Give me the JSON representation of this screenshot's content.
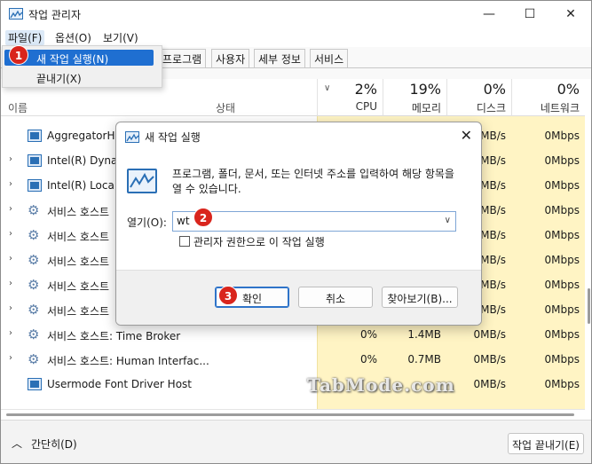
{
  "window": {
    "title": "작업 관리자",
    "controls": [
      "—",
      "☐",
      "✕"
    ]
  },
  "menubar": [
    {
      "label": "파일(F)"
    },
    {
      "label": "옵션(O)"
    },
    {
      "label": "보기(V)"
    }
  ],
  "file_menu": {
    "items": [
      {
        "label": "새 작업 실행(N)"
      },
      {
        "label": "끝내기(X)"
      }
    ]
  },
  "tabs": [
    {
      "label": "프로그램"
    },
    {
      "label": "사용자"
    },
    {
      "label": "세부 정보"
    },
    {
      "label": "서비스"
    }
  ],
  "columns": {
    "name": "이름",
    "status": "상태",
    "cpu": {
      "percent": "2%",
      "label": "CPU"
    },
    "memory": {
      "percent": "19%",
      "label": "메모리"
    },
    "disk": {
      "percent": "0%",
      "label": "디스크"
    },
    "network": {
      "percent": "0%",
      "label": "네트워크"
    }
  },
  "processes": [
    {
      "name": "AggregatorHo",
      "icon": "app-icon",
      "expandable": false,
      "cpu": "",
      "memory": "",
      "disk": "0MB/s",
      "network": "0Mbps"
    },
    {
      "name": "Intel(R) Dynam",
      "icon": "app-icon",
      "expandable": true,
      "cpu": "",
      "memory": "",
      "disk": "0MB/s",
      "network": "0Mbps"
    },
    {
      "name": "Intel(R) Local M",
      "icon": "app-icon",
      "expandable": true,
      "cpu": "",
      "memory": "",
      "disk": "0MB/s",
      "network": "0Mbps"
    },
    {
      "name": "서비스 호스트",
      "icon": "gear-icon",
      "expandable": true,
      "cpu": "",
      "memory": "",
      "disk": "0MB/s",
      "network": "0Mbps"
    },
    {
      "name": "서비스 호스트",
      "icon": "gear-icon",
      "expandable": true,
      "cpu": "",
      "memory": "",
      "disk": "0MB/s",
      "network": "0Mbps"
    },
    {
      "name": "서비스 호스트",
      "icon": "gear-icon",
      "expandable": true,
      "cpu": "",
      "memory": "",
      "disk": "0MB/s",
      "network": "0Mbps"
    },
    {
      "name": "서비스 호스트",
      "icon": "gear-icon",
      "expandable": true,
      "cpu": "",
      "memory": "",
      "disk": "0MB/s",
      "network": "0Mbps"
    },
    {
      "name": "서비스 호스트",
      "icon": "gear-icon",
      "expandable": true,
      "cpu": "",
      "memory": "",
      "disk": "0MB/s",
      "network": "0Mbps"
    },
    {
      "name": "서비스 호스트: Time Broker",
      "icon": "gear-icon",
      "expandable": true,
      "cpu": "0%",
      "memory": "1.4MB",
      "disk": "0MB/s",
      "network": "0Mbps"
    },
    {
      "name": "서비스 호스트: Human Interfac...",
      "icon": "gear-icon",
      "expandable": true,
      "cpu": "0%",
      "memory": "0.7MB",
      "disk": "0MB/s",
      "network": "0Mbps"
    },
    {
      "name": "Usermode Font Driver Host",
      "icon": "app-icon",
      "expandable": false,
      "cpu": "",
      "memory": "",
      "disk": "0MB/s",
      "network": "0Mbps"
    }
  ],
  "footer": {
    "fewer_details": "간단히(D)",
    "end_task": "작업 끝내기(E)"
  },
  "run_dialog": {
    "title": "새 작업 실행",
    "description": "프로그램, 폴더, 문서, 또는 인터넷 주소를 입력하여 해당 항목을 열 수 있습니다.",
    "open_label": "열기(O):",
    "open_value": "wt",
    "admin_checkbox_label": "관리자 권한으로 이 작업 실행",
    "admin_checked": false,
    "ok_label": "확인",
    "cancel_label": "취소",
    "browse_label": "찾아보기(B)..."
  },
  "step_badges": [
    "1",
    "2",
    "3"
  ],
  "watermark": "TabMode.com",
  "colors": {
    "heat": "#fff4c4",
    "highlight": "#1f6fd1",
    "badge": "#d9251d"
  }
}
